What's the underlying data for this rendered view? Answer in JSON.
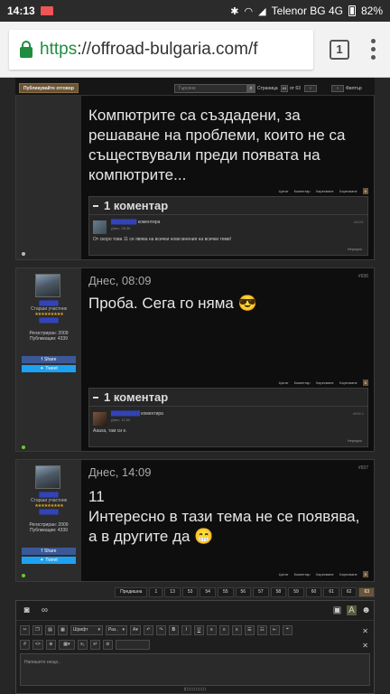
{
  "status_bar": {
    "time": "14:13",
    "carrier": "Telenor BG 4G",
    "battery": "82%"
  },
  "browser": {
    "url_protocol": "https",
    "url_rest": "://offroad-bulgaria.com/f",
    "tab_count": "1"
  },
  "thread_toolbar": {
    "reply_button": "Публикувайте отговор",
    "search_placeholder": "Търсене",
    "pages_label": "Страница",
    "current_page": "63",
    "pages_of": "от 63",
    "filter_label": "Филтър"
  },
  "posts": [
    {
      "message": "Компютрите са създадени, за решаване на проблеми, които не са съществували преди появата на компютрите...",
      "actions": {
        "quote": "Цитат",
        "comment": "Коментар",
        "thanks": "Харесване",
        "likes": "Харесване",
        "like_count": "0"
      },
      "comments_header": "1 коментар",
      "comment": {
        "author": "████████",
        "verb": "коментира",
        "time": "Днес, 08:36",
        "number": "#3231",
        "text": "От скоро това 11 се явява на всички нови мнения на всички теми!",
        "report": "Нередно"
      }
    },
    {
      "date": "Днес, 08:09",
      "number": "#936",
      "user": {
        "name": "██████",
        "rank": "Старши участник",
        "stars": "★★★★★★★★★",
        "sub": "██████",
        "registered": "Регистриран: 2009",
        "posts": "Публикации: 4339",
        "share": "Share",
        "tweet": "Tweet"
      },
      "message": "Проба. Сега го няма 😎",
      "actions": {
        "quote": "Цитат",
        "comment": "Коментар",
        "thanks": "Харесване",
        "likes": "Харесване",
        "like_count": "0"
      },
      "comments_header": "1 коментар",
      "comment": {
        "author": "█████████",
        "verb": "коментира",
        "time": "Днес, 11:50",
        "number": "#936.1",
        "text": "Аааха, там си е.",
        "report": "Нередно"
      }
    },
    {
      "date": "Днес, 14:09",
      "number": "#937",
      "user": {
        "name": "██████",
        "rank": "Старши участник",
        "stars": "★★★★★★★★★",
        "sub": "██████",
        "registered": "Регистриран: 2009",
        "posts": "Публикации: 4339",
        "share": "Share",
        "tweet": "Tweet"
      },
      "message": "11\nИнтересно в тази тема не се появява, а в другите да 😁",
      "actions": {
        "quote": "Цитат",
        "comment": "Коментар",
        "thanks": "Харесване",
        "likes": "Харесване",
        "like_count": "0"
      }
    }
  ],
  "pager": {
    "prev": "Предишна",
    "pages": [
      "1",
      "13",
      "53",
      "54",
      "55",
      "56",
      "57",
      "58",
      "59",
      "60",
      "61",
      "62",
      "63"
    ],
    "current": "63"
  },
  "editor": {
    "font_label": "Шрифт",
    "size_label": "Раз..",
    "placeholder": "Напишете нещо..",
    "post_button": "Публик..",
    "preview_button": "Качване НВ"
  }
}
